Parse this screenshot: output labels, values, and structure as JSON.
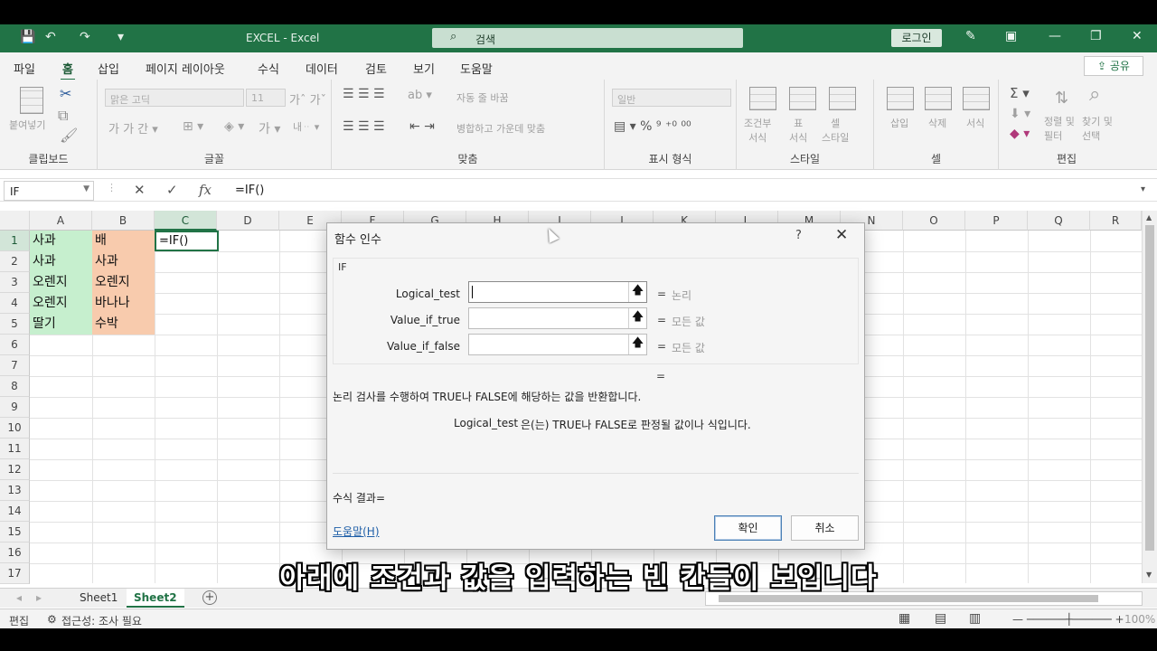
{
  "titlebar": {
    "title": "EXCEL  -  Excel",
    "search_placeholder": "검색",
    "login": "로그인"
  },
  "menu": {
    "tabs": [
      "파일",
      "홈",
      "삽입",
      "페이지 레이아웃",
      "수식",
      "데이터",
      "검토",
      "보기",
      "도움말"
    ],
    "active": "홈",
    "share": "공유"
  },
  "ribbon": {
    "clipboard": {
      "paste": "붙여넣기",
      "label": "클립보드"
    },
    "font": {
      "name": "맑은 고딕",
      "size": "11",
      "label": "글꼴"
    },
    "alignment": {
      "wrap": "자동 줄 바꿈",
      "merge": "병합하고 가운데 맞춤",
      "label": "맞춤"
    },
    "number": {
      "format": "일반",
      "label": "표시 형식"
    },
    "styles": {
      "conditional": "조건부\n서식",
      "table": "표\n서식",
      "cell": "셀\n스타일",
      "label": "스타일"
    },
    "cells": {
      "insert": "삽입",
      "delete": "삭제",
      "format": "서식",
      "label": "셀"
    },
    "editing": {
      "sort": "정렬 및\n필터",
      "find": "찾기 및\n선택",
      "label": "편집"
    }
  },
  "formula_bar": {
    "name_box": "IF",
    "formula": "=IF()"
  },
  "grid": {
    "columns": [
      "A",
      "B",
      "C",
      "D",
      "E",
      "F",
      "G",
      "H",
      "I",
      "J",
      "K",
      "L",
      "M",
      "N",
      "O",
      "P",
      "Q",
      "R"
    ],
    "rows": [
      "1",
      "2",
      "3",
      "4",
      "5",
      "6",
      "7",
      "8",
      "9",
      "10",
      "11",
      "12",
      "13",
      "14",
      "15",
      "16",
      "17"
    ],
    "col_a": [
      "사과",
      "사과",
      "오렌지",
      "오렌지",
      "딸기"
    ],
    "col_b": [
      "배",
      "사과",
      "오렌지",
      "바나나",
      "수박"
    ],
    "active_cell": "=IF()"
  },
  "sheets": {
    "tabs": [
      "Sheet1",
      "Sheet2"
    ],
    "active": "Sheet2"
  },
  "status": {
    "mode": "편집",
    "accessibility": "접근성: 조사 필요",
    "zoom": "100%"
  },
  "dialog": {
    "title": "함수 인수",
    "function_name": "IF",
    "args": [
      {
        "label": "Logical_test",
        "type": "논리"
      },
      {
        "label": "Value_if_true",
        "type": "모든 값"
      },
      {
        "label": "Value_if_false",
        "type": "모든 값"
      }
    ],
    "equals": "=",
    "description": "논리 검사를 수행하여 TRUE나 FALSE에 해당하는 값을 반환합니다.",
    "arg_desc_name": "Logical_test",
    "arg_desc_text": "은(는) TRUE나 FALSE로 판정될 값이나 식입니다.",
    "result_label": "수식 결과=",
    "help_link": "도움말(H)",
    "ok": "확인",
    "cancel": "취소"
  },
  "subtitle": "아래에 조건과 값을 입력하는 빈 칸들이 보입니다",
  "colors": {
    "excel_green": "#217346",
    "cell_green": "#c6efce",
    "cell_orange": "#f8cbad"
  }
}
